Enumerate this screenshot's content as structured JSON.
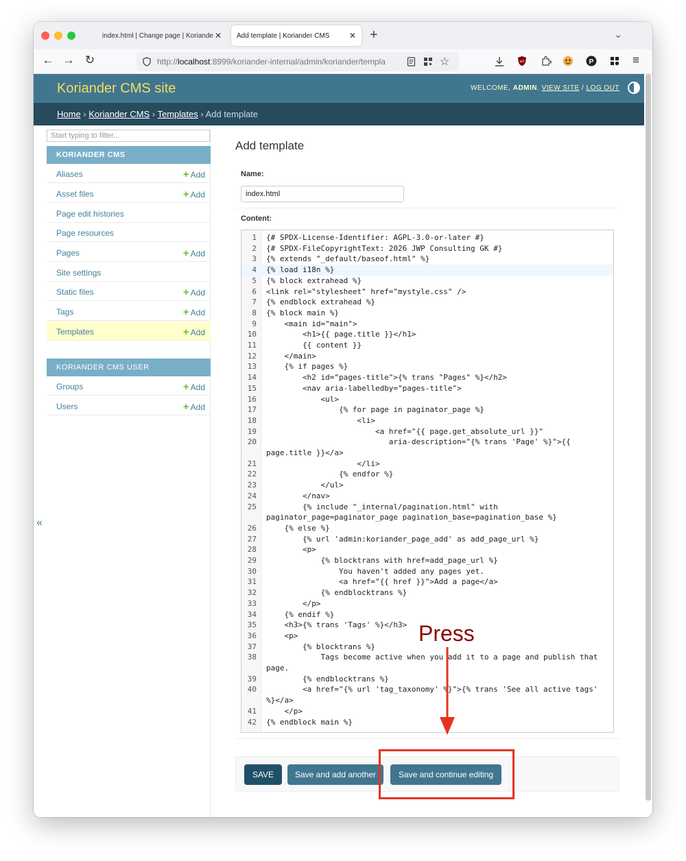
{
  "browser": {
    "tabs": [
      {
        "label": "index.html | Change page | Koriander CMS",
        "active": false
      },
      {
        "label": "Add template | Koriander CMS",
        "active": true
      }
    ],
    "url_display": "http://localhost:8999/koriander-internal/admin/koriander/templ",
    "url_prefix": "http://",
    "url_host": "localhost",
    "url_rest": ":8999/koriander-internal/admin/koriander/templa"
  },
  "header": {
    "site_name": "Koriander CMS site",
    "welcome": "WELCOME, ",
    "user": "ADMIN",
    "view_site": "VIEW SITE",
    "separator": " / ",
    "log_out": "LOG OUT"
  },
  "breadcrumbs": {
    "home": "Home",
    "app": "Koriander CMS",
    "model": "Templates",
    "current": "Add template",
    "sep": " › "
  },
  "sidebar": {
    "filter_placeholder": "Start typing to filter...",
    "modules": [
      {
        "title": "KORIANDER CMS",
        "items": [
          {
            "label": "Aliases",
            "add": "Add"
          },
          {
            "label": "Asset files",
            "add": "Add"
          },
          {
            "label": "Page edit histories",
            "add": ""
          },
          {
            "label": "Page resources",
            "add": ""
          },
          {
            "label": "Pages",
            "add": "Add"
          },
          {
            "label": "Site settings",
            "add": ""
          },
          {
            "label": "Static files",
            "add": "Add"
          },
          {
            "label": "Tags",
            "add": "Add"
          },
          {
            "label": "Templates",
            "add": "Add",
            "selected": true
          }
        ]
      },
      {
        "title": "KORIANDER CMS USER",
        "items": [
          {
            "label": "Groups",
            "add": "Add"
          },
          {
            "label": "Users",
            "add": "Add"
          }
        ]
      }
    ],
    "collapse_label": "«"
  },
  "form": {
    "title": "Add template",
    "name_label": "Name:",
    "name_value": "index.html",
    "content_label": "Content:",
    "code_lines": [
      {
        "n": "1",
        "t": "{# SPDX-License-Identifier: AGPL-3.0-or-later #}"
      },
      {
        "n": "2",
        "t": "{# SPDX-FileCopyrightText: 2026 JWP Consulting GK #}"
      },
      {
        "n": "3",
        "t": "{% extends \"_default/baseof.html\" %}"
      },
      {
        "n": "4",
        "t": "{% load i18n %}"
      },
      {
        "n": "5",
        "t": "{% block extrahead %}"
      },
      {
        "n": "6",
        "t": "<link rel=\"stylesheet\" href=\"mystyle.css\" />"
      },
      {
        "n": "7",
        "t": "{% endblock extrahead %}"
      },
      {
        "n": "8",
        "t": "{% block main %}"
      },
      {
        "n": "9",
        "t": "    <main id=\"main\">"
      },
      {
        "n": "10",
        "t": "        <h1>{{ page.title }}</h1>"
      },
      {
        "n": "11",
        "t": "        {{ content }}"
      },
      {
        "n": "12",
        "t": "    </main>"
      },
      {
        "n": "13",
        "t": "    {% if pages %}"
      },
      {
        "n": "14",
        "t": "        <h2 id=\"pages-title\">{% trans \"Pages\" %}</h2>"
      },
      {
        "n": "15",
        "t": "        <nav aria-labelledby=\"pages-title\">"
      },
      {
        "n": "16",
        "t": "            <ul>"
      },
      {
        "n": "17",
        "t": "                {% for page in paginator_page %}"
      },
      {
        "n": "18",
        "t": "                    <li>"
      },
      {
        "n": "19",
        "t": "                        <a href=\"{{ page.get_absolute_url }}\""
      },
      {
        "n": "20",
        "t": "                           aria-description=\"{% trans 'Page' %}\">{{"
      },
      {
        "n": "",
        "t": "page.title }}</a>"
      },
      {
        "n": "21",
        "t": "                    </li>"
      },
      {
        "n": "22",
        "t": "                {% endfor %}"
      },
      {
        "n": "23",
        "t": "            </ul>"
      },
      {
        "n": "24",
        "t": "        </nav>"
      },
      {
        "n": "25",
        "t": "        {% include \"_internal/pagination.html\" with"
      },
      {
        "n": "",
        "t": "paginator_page=paginator_page pagination_base=pagination_base %}"
      },
      {
        "n": "26",
        "t": "    {% else %}"
      },
      {
        "n": "27",
        "t": "        {% url 'admin:koriander_page_add' as add_page_url %}"
      },
      {
        "n": "28",
        "t": "        <p>"
      },
      {
        "n": "29",
        "t": "            {% blocktrans with href=add_page_url %}"
      },
      {
        "n": "30",
        "t": "                You haven't added any pages yet."
      },
      {
        "n": "31",
        "t": "                <a href=\"{{ href }}\">Add a page</a>"
      },
      {
        "n": "32",
        "t": "            {% endblocktrans %}"
      },
      {
        "n": "33",
        "t": "        </p>"
      },
      {
        "n": "34",
        "t": "    {% endif %}"
      },
      {
        "n": "35",
        "t": "    <h3>{% trans 'Tags' %}</h3>"
      },
      {
        "n": "36",
        "t": "    <p>"
      },
      {
        "n": "37",
        "t": "        {% blocktrans %}"
      },
      {
        "n": "38",
        "t": "            Tags become active when you add it to a page and publish that"
      },
      {
        "n": "",
        "t": "page."
      },
      {
        "n": "39",
        "t": "        {% endblocktrans %}"
      },
      {
        "n": "40",
        "t": "        <a href=\"{% url 'tag_taxonomy' %}\">{% trans 'See all active tags'"
      },
      {
        "n": "",
        "t": "%}</a>"
      },
      {
        "n": "41",
        "t": "    </p>"
      },
      {
        "n": "42",
        "t": "{% endblock main %}"
      }
    ],
    "active_line": "4",
    "buttons": {
      "save": "SAVE",
      "save_add_another": "Save and add another",
      "save_continue": "Save and continue editing"
    }
  },
  "annotation": {
    "label": "Press",
    "color": "#8b0000",
    "box_color": "#e53322"
  },
  "colors": {
    "header": "#417690",
    "breadcrumbs": "#264b5d",
    "module_header": "#79aec8",
    "brand_text": "#f5dd5d",
    "link": "#447e9b",
    "add_plus": "#70bf2b",
    "selected_row": "#ffffcc"
  }
}
